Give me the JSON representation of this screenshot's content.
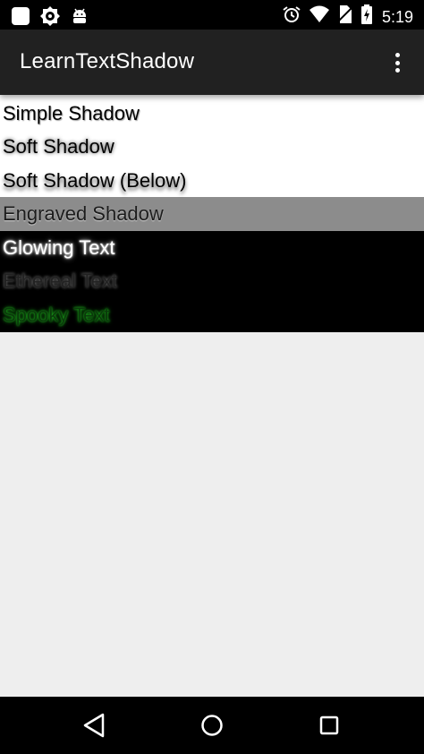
{
  "status_bar": {
    "time": "5:19",
    "left_icons": [
      "app-square-icon",
      "settings-gear-icon",
      "android-icon"
    ],
    "right_icons": [
      "alarm-icon",
      "wifi-icon",
      "no-sim-icon",
      "battery-icon"
    ]
  },
  "app_bar": {
    "title": "LearnTextShadow",
    "overflow_icon": "more-vert-icon"
  },
  "list": {
    "items": [
      {
        "label": "Simple Shadow",
        "bg": "#ffffff"
      },
      {
        "label": "Soft Shadow",
        "bg": "#ffffff"
      },
      {
        "label": "Soft Shadow (Below)",
        "bg": "#ffffff"
      },
      {
        "label": "Engraved Shadow",
        "bg": "#8c8c8c"
      },
      {
        "label": "Glowing Text",
        "bg": "#000000"
      },
      {
        "label": "Ethereal Text",
        "bg": "#000000"
      },
      {
        "label": "Spooky Text",
        "bg": "#000000"
      }
    ]
  },
  "nav_bar": {
    "buttons": [
      "back-icon",
      "home-icon",
      "recents-icon"
    ]
  },
  "colors": {
    "status_bar": "#000000",
    "app_bar": "#212121",
    "content_bg": "#eeeeee",
    "spooky_glow": "#1db31d"
  }
}
